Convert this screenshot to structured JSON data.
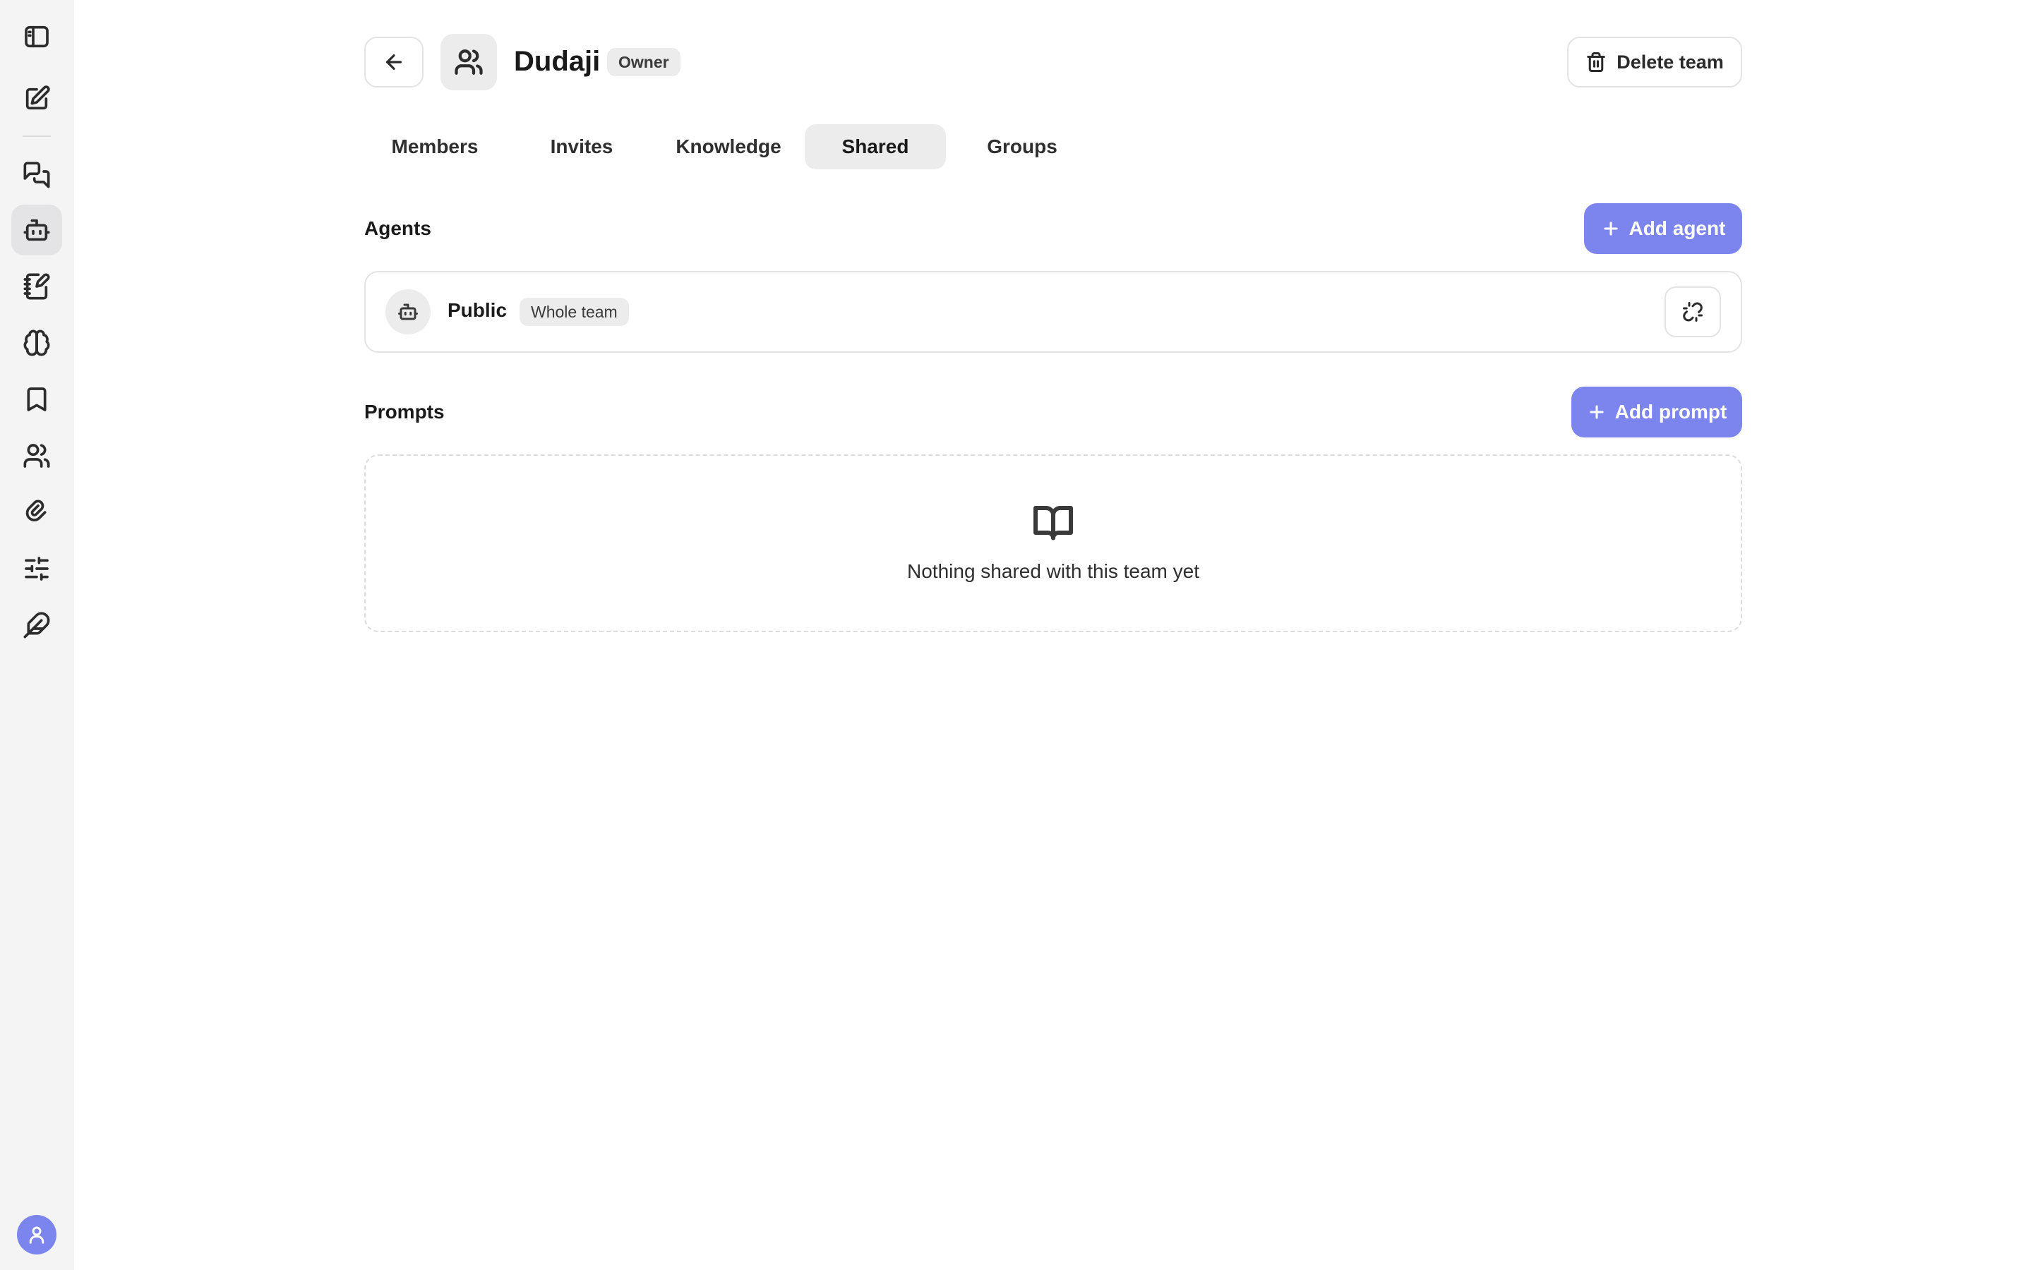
{
  "sidebar": {
    "items": [
      {
        "icon": "panel-toggle-icon"
      },
      {
        "icon": "new-chat-icon"
      },
      {
        "icon": "conversations-icon"
      },
      {
        "icon": "agents-icon",
        "active": true
      },
      {
        "icon": "notebook-icon"
      },
      {
        "icon": "brain-icon"
      },
      {
        "icon": "bookmark-icon"
      },
      {
        "icon": "teams-icon"
      },
      {
        "icon": "attachments-icon"
      },
      {
        "icon": "settings-sliders-icon"
      },
      {
        "icon": "feather-icon"
      }
    ],
    "avatar_icon": "user-icon"
  },
  "header": {
    "team_name": "Dudaji",
    "role_badge": "Owner",
    "delete_label": "Delete team"
  },
  "tabs": [
    {
      "label": "Members"
    },
    {
      "label": "Invites"
    },
    {
      "label": "Knowledge"
    },
    {
      "label": "Shared",
      "active": true
    },
    {
      "label": "Groups"
    }
  ],
  "agents": {
    "title": "Agents",
    "add_label": "Add agent",
    "items": [
      {
        "name": "Public",
        "scope": "Whole team"
      }
    ]
  },
  "prompts": {
    "title": "Prompts",
    "add_label": "Add prompt",
    "empty_text": "Nothing shared with this team yet"
  },
  "colors": {
    "accent": "#7c84ee",
    "sidebar_bg": "#f4f4f5",
    "badge_bg": "#ececec"
  }
}
